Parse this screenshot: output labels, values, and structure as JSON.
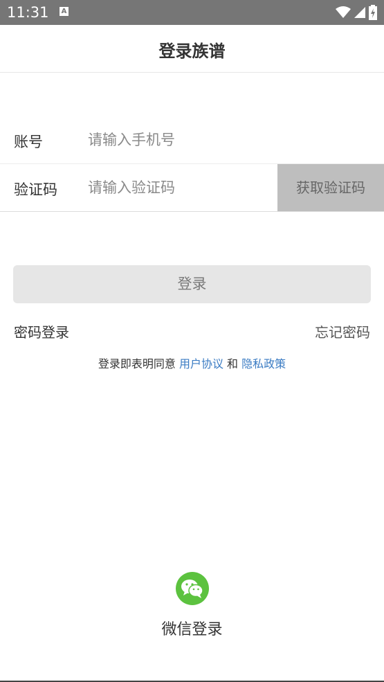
{
  "status_bar": {
    "time": "11:31",
    "notification_glyph": "A"
  },
  "header": {
    "title": "登录族谱"
  },
  "form": {
    "account_label": "账号",
    "account_placeholder": "请输入手机号",
    "code_label": "验证码",
    "code_placeholder": "请输入验证码",
    "get_code_label": "获取验证码"
  },
  "actions": {
    "login_label": "登录",
    "password_login": "密码登录",
    "forgot_password": "忘记密码"
  },
  "agreement": {
    "prefix": "登录即表明同意 ",
    "user_agreement": "用户协议",
    "and": " 和 ",
    "privacy_policy": "隐私政策"
  },
  "wechat": {
    "label": "微信登录",
    "icon": "wechat-icon"
  },
  "colors": {
    "status_bar": "#767676",
    "link": "#3a7bc3",
    "wechat_green": "#5cc23f",
    "code_button": "#bebebe",
    "login_button": "#e6e6e6"
  }
}
